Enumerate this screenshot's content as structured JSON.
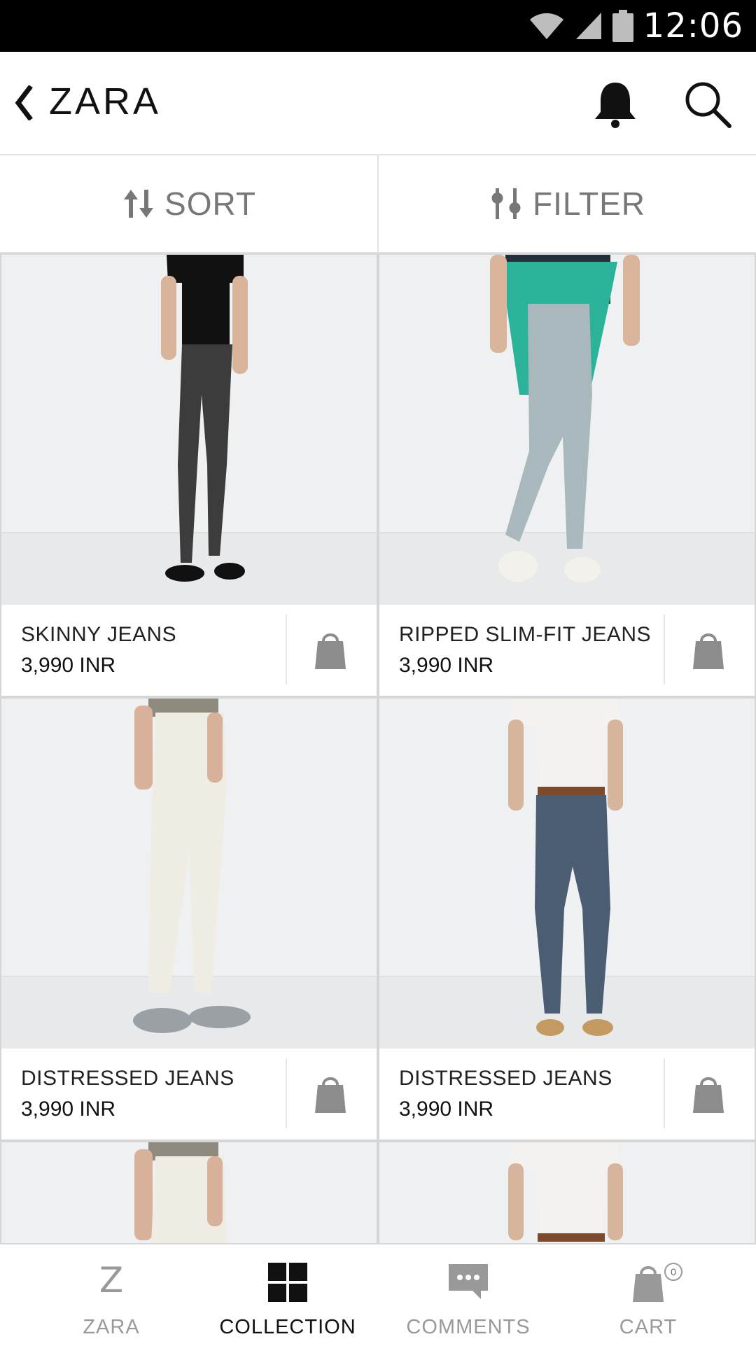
{
  "status_bar": {
    "time": "12:06"
  },
  "header": {
    "title": "ZARA"
  },
  "toolbar": {
    "sort_label": "SORT",
    "filter_label": "FILTER"
  },
  "products": [
    {
      "name": "SKINNY JEANS",
      "price": "3,990 INR"
    },
    {
      "name": "RIPPED SLIM-FIT JEANS",
      "price": "3,990 INR"
    },
    {
      "name": "DISTRESSED JEANS",
      "price": "3,990 INR"
    },
    {
      "name": "DISTRESSED JEANS",
      "price": "3,990 INR"
    }
  ],
  "bottom_nav": {
    "items": [
      {
        "label": "ZARA",
        "icon": "z-logo-icon",
        "logo_text": "Z"
      },
      {
        "label": "COLLECTION",
        "icon": "grid-icon",
        "active": true
      },
      {
        "label": "COMMENTS",
        "icon": "chat-bubble-icon"
      },
      {
        "label": "CART",
        "icon": "shopping-bag-icon",
        "count": "0"
      }
    ]
  },
  "colors": {
    "accent": "#111111",
    "muted": "#999999",
    "icon_gray": "#8c8c8c",
    "sweater_green": "#2bb39a"
  }
}
